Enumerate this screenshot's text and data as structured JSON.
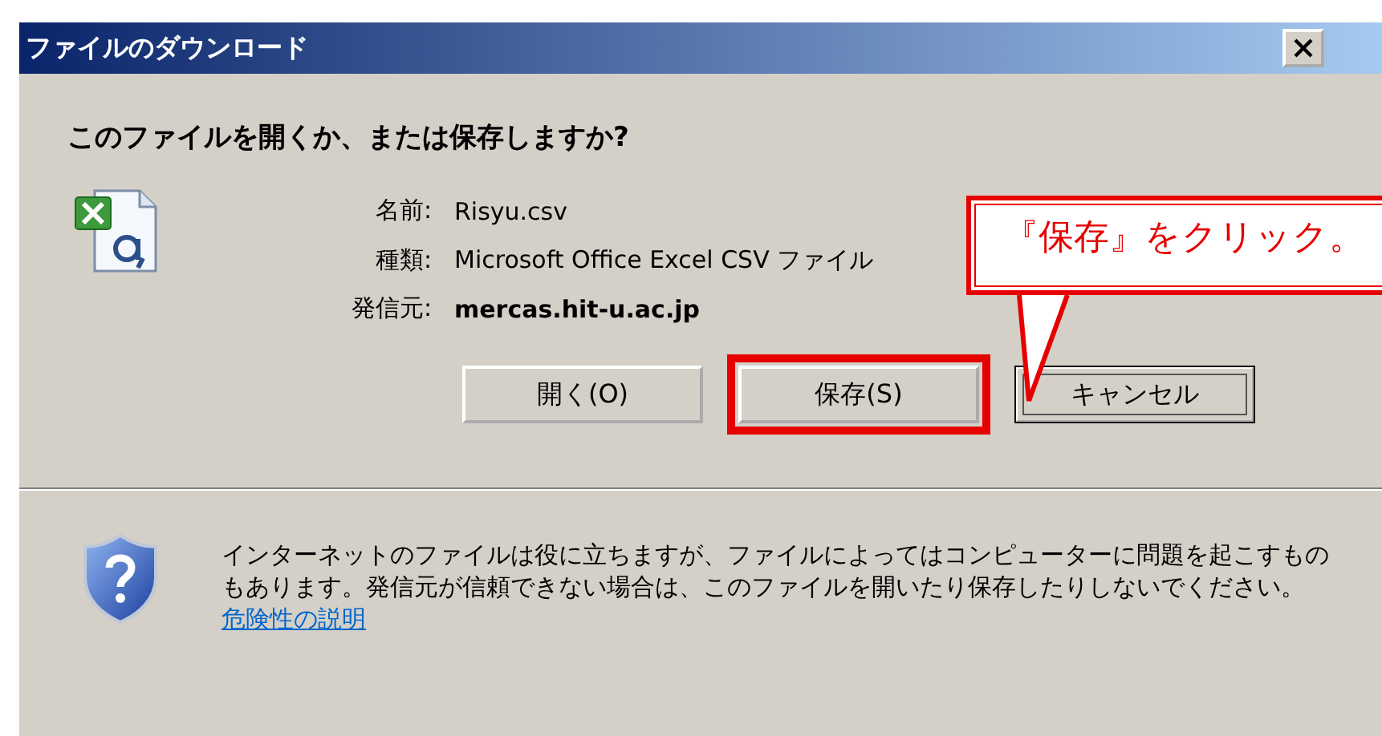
{
  "window": {
    "title": "ファイルのダウンロード"
  },
  "question": "このファイルを開くか、または保存しますか?",
  "file_info": [
    {
      "label": "名前:",
      "value": "Risyu.csv",
      "bold": false
    },
    {
      "label": "種類:",
      "value": "Microsoft Office Excel CSV ファイル",
      "bold": false
    },
    {
      "label": "発信元:",
      "value": "mercas.hit-u.ac.jp",
      "bold": true
    }
  ],
  "buttons": [
    {
      "label": "開く(O)",
      "focused": false,
      "highlighted": false
    },
    {
      "label": "保存(S)",
      "focused": false,
      "highlighted": true
    },
    {
      "label": "キャンセル",
      "focused": true,
      "highlighted": false
    }
  ],
  "warning": {
    "text": "インターネットのファイルは役に立ちますが、ファイルによってはコンピューターに問題を起こすものもあります。発信元が信頼できない場合は、このファイルを開いたり保存したりしないでください。",
    "link": "危険性の説明"
  },
  "annotation": "『保存』をクリック。"
}
